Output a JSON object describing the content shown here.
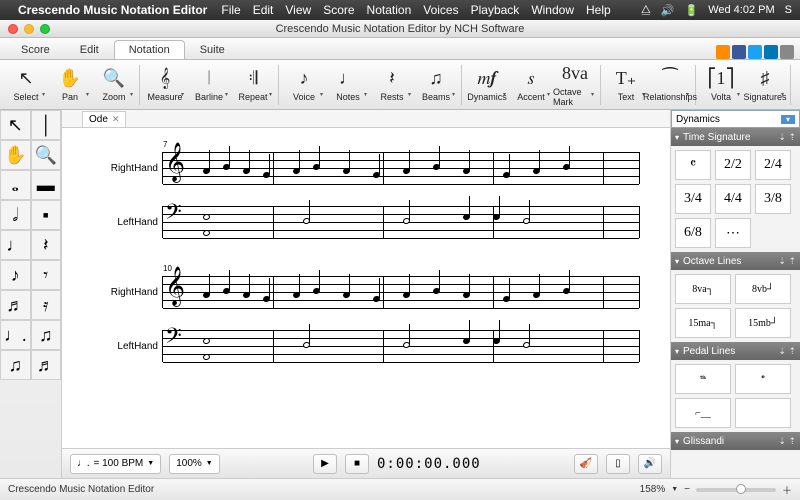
{
  "mac": {
    "app": "Crescendo Music Notation Editor",
    "menus": [
      "File",
      "Edit",
      "View",
      "Score",
      "Notation",
      "Voices",
      "Playback",
      "Window",
      "Help"
    ],
    "clock": "Wed 4:02 PM",
    "user": "S"
  },
  "window": {
    "title": "Crescendo Music Notation Editor by NCH Software"
  },
  "tabs": {
    "items": [
      "Score",
      "Edit",
      "Notation",
      "Suite"
    ],
    "active": 2
  },
  "ribbon": {
    "groups": [
      [
        {
          "icon": "↖",
          "label": "Select"
        },
        {
          "icon": "✋",
          "label": "Pan"
        },
        {
          "icon": "🔍",
          "label": "Zoom"
        }
      ],
      [
        {
          "icon": "𝄞",
          "label": "Measure"
        },
        {
          "icon": "𝄀",
          "label": "Barline"
        },
        {
          "icon": "𝄇",
          "label": "Repeat"
        }
      ],
      [
        {
          "icon": "♪",
          "label": "Voice"
        },
        {
          "icon": "♩",
          "label": "Notes"
        },
        {
          "icon": "𝄽",
          "label": "Rests"
        },
        {
          "icon": "♫",
          "label": "Beams"
        }
      ],
      [
        {
          "icon": "𝆐𝆑",
          "label": "Dynamics"
        },
        {
          "icon": "𝆍",
          "label": "Accent"
        },
        {
          "icon": "8va",
          "label": "Octave Mark"
        }
      ],
      [
        {
          "icon": "T₊",
          "label": "Text"
        },
        {
          "icon": "⁀",
          "label": "Relationships"
        }
      ],
      [
        {
          "icon": "⎡1⎤",
          "label": "Volta"
        },
        {
          "icon": "♯",
          "label": "Signatures"
        }
      ]
    ]
  },
  "document": {
    "tab": "Ode"
  },
  "score": {
    "systems": [
      {
        "measure": 7,
        "staves": [
          {
            "label": "RightHand",
            "clef": "𝄞"
          },
          {
            "label": "LeftHand",
            "clef": "𝄢"
          }
        ]
      },
      {
        "measure": 10,
        "staves": [
          {
            "label": "RightHand",
            "clef": "𝄞"
          },
          {
            "label": "LeftHand",
            "clef": "𝄢"
          }
        ]
      }
    ]
  },
  "transport": {
    "tempo_note": "♩.",
    "tempo": "= 100 BPM",
    "zoom": "100%",
    "time": "0:00:00.000"
  },
  "rightPanel": {
    "selector": "Dynamics",
    "sections": [
      {
        "title": "Time Signature",
        "cells": [
          "𝄴",
          "2/2",
          "2/4",
          "3/4",
          "4/4",
          "3/8",
          "6/8",
          "⋯"
        ]
      },
      {
        "title": "Octave Lines",
        "cells": [
          "8va┐",
          "8vb┘",
          "15ma┐",
          "15mb┘"
        ],
        "wide": true
      },
      {
        "title": "Pedal Lines",
        "cells": [
          "𝆮",
          "𝆯",
          "⌐__",
          ""
        ],
        "wide": true
      },
      {
        "title": "Glissandi",
        "cells": []
      }
    ]
  },
  "status": {
    "text": "Crescendo Music Notation Editor",
    "zoom": "158%"
  },
  "left_palette": [
    [
      "↖",
      "│"
    ],
    [
      "✋",
      "🔍"
    ],
    [
      "𝅝",
      "▬"
    ],
    [
      "𝅗𝅥",
      "▪"
    ],
    [
      "♩",
      "𝄽"
    ],
    [
      "♪",
      "𝄾"
    ],
    [
      "♬",
      "𝄿"
    ],
    [
      "♩.",
      "♫"
    ],
    [
      "♫",
      "♬"
    ]
  ]
}
